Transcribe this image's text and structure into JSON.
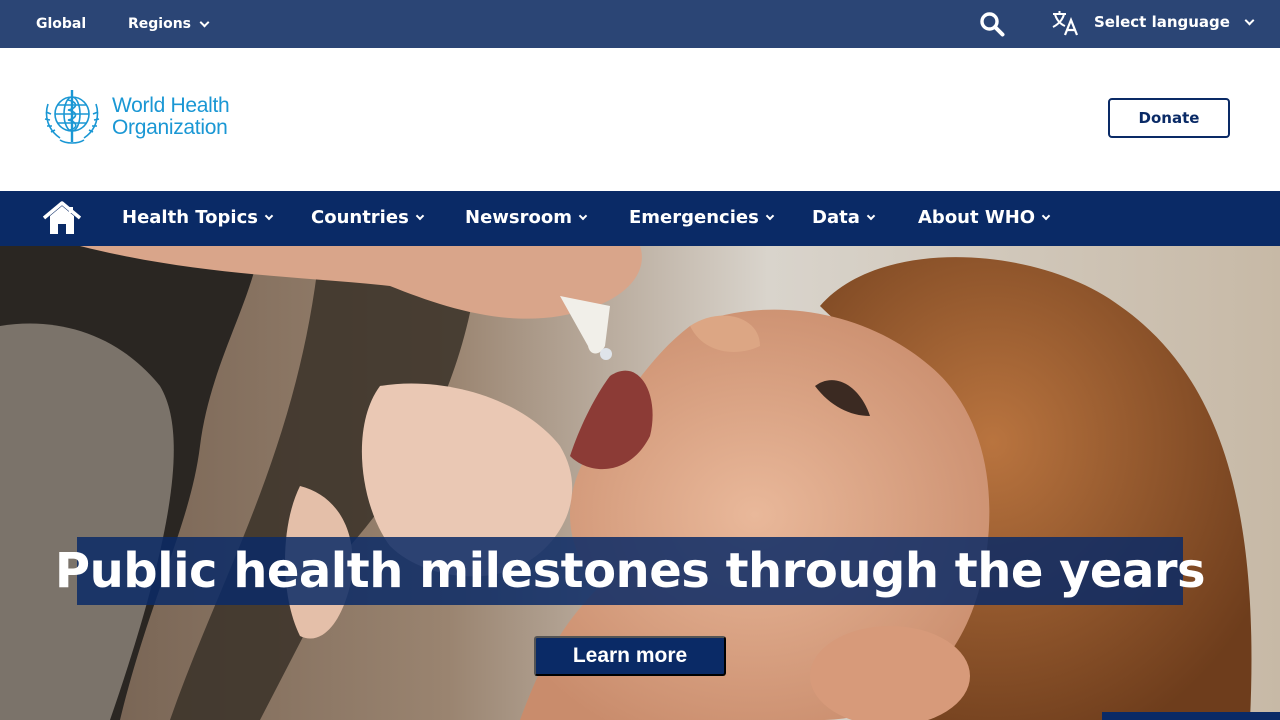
{
  "topbar": {
    "global_label": "Global",
    "regions_label": "Regions",
    "search_icon": "search-icon",
    "translate_icon": "translate-icon",
    "language_label": "Select language"
  },
  "header": {
    "logo_line1": "World Health",
    "logo_line2": "Organization",
    "donate_label": "Donate"
  },
  "nav": {
    "home_icon": "home-icon",
    "items": [
      {
        "label": "Health Topics"
      },
      {
        "label": "Countries"
      },
      {
        "label": "Newsroom"
      },
      {
        "label": "Emergencies"
      },
      {
        "label": "Data"
      },
      {
        "label": "About WHO"
      }
    ]
  },
  "hero": {
    "headline": "Public health milestones through the years",
    "cta_label": "Learn more"
  },
  "colors": {
    "topbar": "#2b4575",
    "nav": "#0a2a66",
    "brand_blue": "#1a97d4",
    "text_white": "#ffffff"
  }
}
